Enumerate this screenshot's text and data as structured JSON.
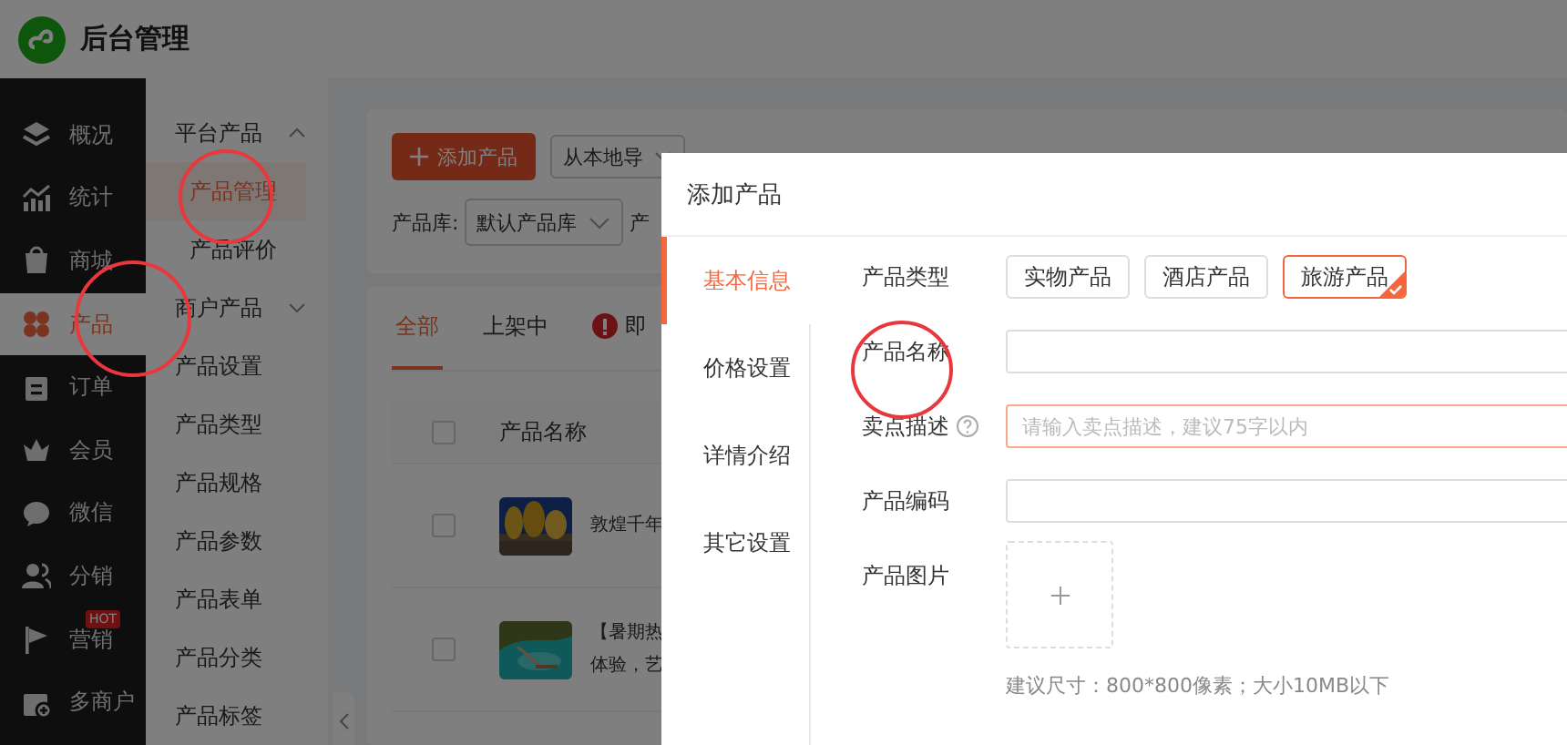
{
  "header": {
    "title": "后台管理"
  },
  "sidebar": {
    "items": [
      {
        "label": "概况",
        "selected": false
      },
      {
        "label": "统计",
        "selected": false
      },
      {
        "label": "商城",
        "selected": false
      },
      {
        "label": "产品",
        "selected": true
      },
      {
        "label": "订单",
        "selected": false
      },
      {
        "label": "会员",
        "selected": false
      },
      {
        "label": "微信",
        "selected": false
      },
      {
        "label": "分销",
        "selected": false
      },
      {
        "label": "营销",
        "selected": false,
        "badge": "HOT"
      },
      {
        "label": "多商户",
        "selected": false
      }
    ]
  },
  "submenu": [
    {
      "kind": "group",
      "label": "平台产品",
      "expanded": true,
      "children": [
        {
          "label": "产品管理",
          "selected": true
        },
        {
          "label": "产品评价",
          "selected": false
        }
      ]
    },
    {
      "kind": "group",
      "label": "商户产品",
      "expanded": false
    },
    {
      "kind": "item",
      "label": "产品设置",
      "selected": false
    },
    {
      "kind": "item",
      "label": "产品类型",
      "selected": false
    },
    {
      "kind": "item",
      "label": "产品规格",
      "selected": false
    },
    {
      "kind": "item",
      "label": "产品参数",
      "selected": false
    },
    {
      "kind": "item",
      "label": "产品表单",
      "selected": false
    },
    {
      "kind": "item",
      "label": "产品分类",
      "selected": false
    },
    {
      "kind": "item",
      "label": "产品标签",
      "selected": false
    }
  ],
  "toolbar": {
    "add_button": "添加产品",
    "import_buttons": [
      "从本地导"
    ],
    "filter": {
      "label": "产品库:",
      "value": "默认产品库"
    },
    "filter_2_label": "产"
  },
  "tabs": [
    {
      "label": "全部",
      "selected": true,
      "warning": false
    },
    {
      "label": "上架中",
      "selected": false,
      "warning": false
    },
    {
      "label": "即",
      "selected": false,
      "warning": true
    }
  ],
  "table": {
    "header_checked": false,
    "columns": [
      "产品名称"
    ],
    "rows": [
      {
        "checked": false,
        "name_lines": [
          "敦煌千年"
        ]
      },
      {
        "checked": false,
        "name_lines": [
          "【暑期热",
          "体验，艺"
        ]
      }
    ]
  },
  "dialog": {
    "title": "添加产品",
    "tabs": [
      {
        "label": "基本信息",
        "selected": true
      },
      {
        "label": "价格设置",
        "selected": false
      },
      {
        "label": "详情介绍",
        "selected": false
      },
      {
        "label": "其它设置",
        "selected": false
      }
    ],
    "fields": [
      {
        "kind": "options",
        "label": "产品类型",
        "options": [
          {
            "label": "实物产品",
            "selected": false
          },
          {
            "label": "酒店产品",
            "selected": false
          },
          {
            "label": "旅游产品",
            "selected": true
          }
        ]
      },
      {
        "kind": "text",
        "label": "产品名称",
        "focused": false
      },
      {
        "kind": "text",
        "label": "卖点描述",
        "help": true,
        "focused": true,
        "placeholder": "请输入卖点描述，建议75字以内"
      },
      {
        "kind": "text",
        "label": "产品编码",
        "focused": false
      },
      {
        "kind": "upload",
        "label": "产品图片",
        "hint": "建议尺寸：800*800像素；大小10MB以下"
      }
    ]
  }
}
